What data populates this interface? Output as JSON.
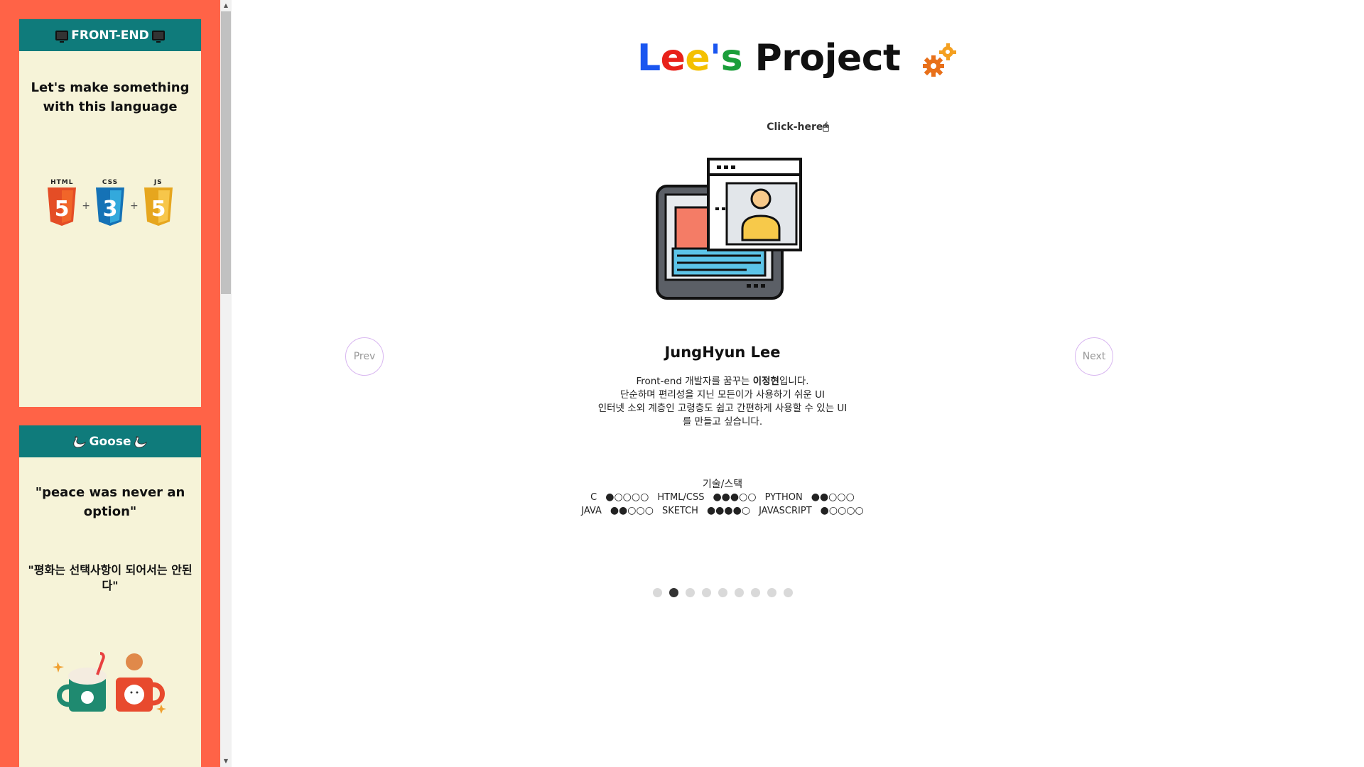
{
  "sidebar": {
    "card1": {
      "header": "FRONT-END",
      "text": "Let's make something with this language",
      "logos": [
        "HTML",
        "CSS",
        "JS"
      ],
      "plus": "+"
    },
    "card2": {
      "header": "Goose",
      "quote_en": "\"peace was never an option\"",
      "quote_ko": "\"평화는 선택사항이 되어서는 안된다\""
    }
  },
  "main": {
    "title": {
      "l": "L",
      "e1": "e",
      "e2": "e",
      "apos": "'",
      "s": "s",
      "rest": " Project"
    },
    "click_here": "Click-here🖱",
    "prev": "Prev",
    "next": "Next",
    "name": "JungHyun Lee",
    "intro": {
      "line1_pre": "Front-end 개발자를 꿈꾸는 ",
      "line1_bold": "이정현",
      "line1_post": "입니다.",
      "line2": "단순하며 편리성을 지닌 모든이가 사용하기 쉬운 UI",
      "line3": "인터넷 소외 계층인 고령층도 쉽고 간편하게 사용할 수 있는 UI",
      "line4": "를 만들고 싶습니다."
    },
    "skills_title": "기술/스택",
    "skills_row1": [
      {
        "name": "C",
        "dots": "●○○○○"
      },
      {
        "name": "HTML/CSS",
        "dots": "●●●○○"
      },
      {
        "name": "PYTHON",
        "dots": "●●○○○"
      }
    ],
    "skills_row2": [
      {
        "name": "JAVA",
        "dots": "●●○○○"
      },
      {
        "name": "SKETCH",
        "dots": "●●●●○"
      },
      {
        "name": "JAVASCRIPT",
        "dots": "●○○○○"
      }
    ],
    "pager": {
      "count": 9,
      "active": 1
    }
  },
  "colors": {
    "sidebar_bg": "#ff6347",
    "card_bg": "#f6f3d8",
    "card_header": "#0f7b7b"
  }
}
